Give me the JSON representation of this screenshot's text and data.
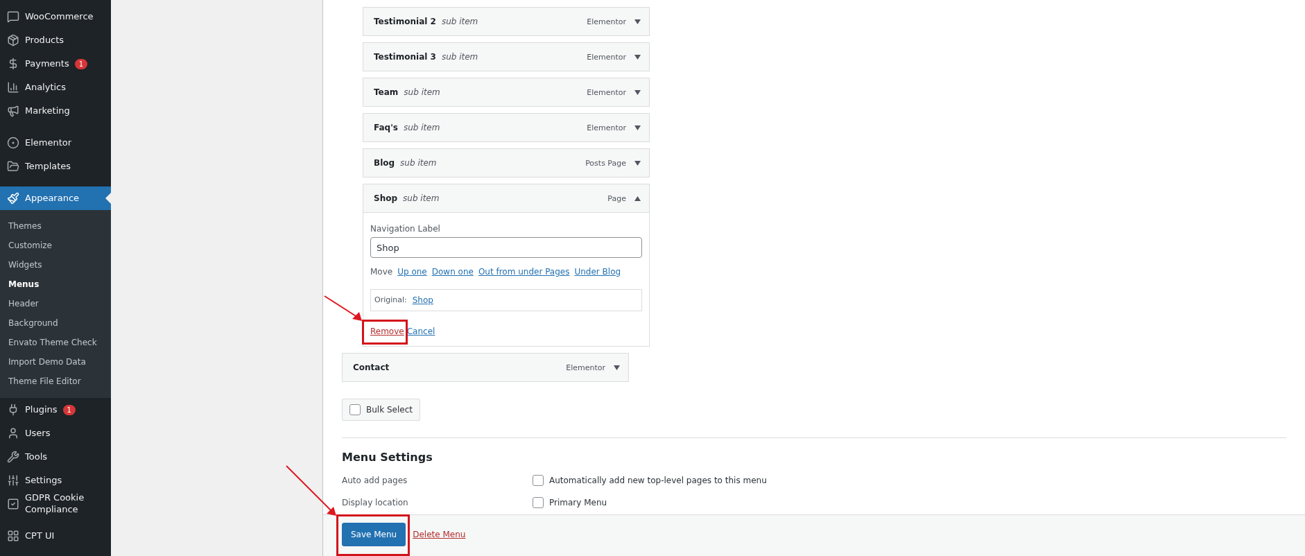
{
  "sidebar": {
    "items": [
      {
        "label": "WooCommerce",
        "selected": false
      },
      {
        "label": "Products",
        "selected": false
      },
      {
        "label": "Payments",
        "selected": false,
        "badge": "1"
      },
      {
        "label": "Analytics",
        "selected": false
      },
      {
        "label": "Marketing",
        "selected": false,
        "separator_after": true
      },
      {
        "label": "Elementor",
        "selected": false
      },
      {
        "label": "Templates",
        "selected": false,
        "separator_after": true
      },
      {
        "label": "Appearance",
        "selected": true,
        "children": [
          {
            "label": "Themes",
            "selected": false
          },
          {
            "label": "Customize",
            "selected": false
          },
          {
            "label": "Widgets",
            "selected": false
          },
          {
            "label": "Menus",
            "selected": true
          },
          {
            "label": "Header",
            "selected": false
          },
          {
            "label": "Background",
            "selected": false
          },
          {
            "label": "Envato Theme Check",
            "selected": false
          },
          {
            "label": "Import Demo Data",
            "selected": false
          },
          {
            "label": "Theme File Editor",
            "selected": false
          }
        ]
      },
      {
        "label": "Plugins",
        "selected": false,
        "badge": "1"
      },
      {
        "label": "Users",
        "selected": false
      },
      {
        "label": "Tools",
        "selected": false
      },
      {
        "label": "Settings",
        "selected": false
      },
      {
        "label": "GDPR Cookie Compliance",
        "selected": false,
        "separator_after": true
      },
      {
        "label": "CPT UI",
        "selected": false
      }
    ]
  },
  "menu_items": [
    {
      "title": "Testimonial 2",
      "meta": "sub item",
      "type": "Elementor",
      "kind": "sub",
      "expanded": false
    },
    {
      "title": "Testimonial 3",
      "meta": "sub item",
      "type": "Elementor",
      "kind": "sub",
      "expanded": false
    },
    {
      "title": "Team",
      "meta": "sub item",
      "type": "Elementor",
      "kind": "sub",
      "expanded": false
    },
    {
      "title": "Faq's",
      "meta": "sub item",
      "type": "Elementor",
      "kind": "sub",
      "expanded": false
    },
    {
      "title": "Blog",
      "meta": "sub item",
      "type": "Posts Page",
      "kind": "sub",
      "expanded": false
    },
    {
      "title": "Shop",
      "meta": "sub item",
      "type": "Page",
      "kind": "sub",
      "expanded": true,
      "settings": {
        "label": "Navigation Label",
        "value": "Shop",
        "move_label": "Move",
        "move_links": [
          "Up one",
          "Down one",
          "Out from under Pages",
          "Under Blog"
        ],
        "original_label": "Original:",
        "original_link": "Shop",
        "actions": [
          {
            "label": "Remove",
            "kind": "danger",
            "highlighted": true
          },
          {
            "label": "Cancel",
            "kind": "link",
            "highlighted": false
          }
        ]
      }
    },
    {
      "title": "Contact",
      "type": "Elementor",
      "kind": "top",
      "expanded": false
    }
  ],
  "bulk_select": {
    "label": "Bulk Select",
    "checked": false
  },
  "menu_settings": {
    "title": "Menu Settings",
    "rows": [
      {
        "label": "Auto add pages",
        "options": [
          {
            "label": "Automatically add new top-level pages to this menu",
            "checked": false
          }
        ]
      },
      {
        "label": "Display location",
        "options": [
          {
            "label": "Primary Menu",
            "checked": false
          }
        ]
      }
    ]
  },
  "footer": {
    "save": {
      "label": "Save Menu",
      "highlighted": true
    },
    "delete": "Delete Menu"
  }
}
